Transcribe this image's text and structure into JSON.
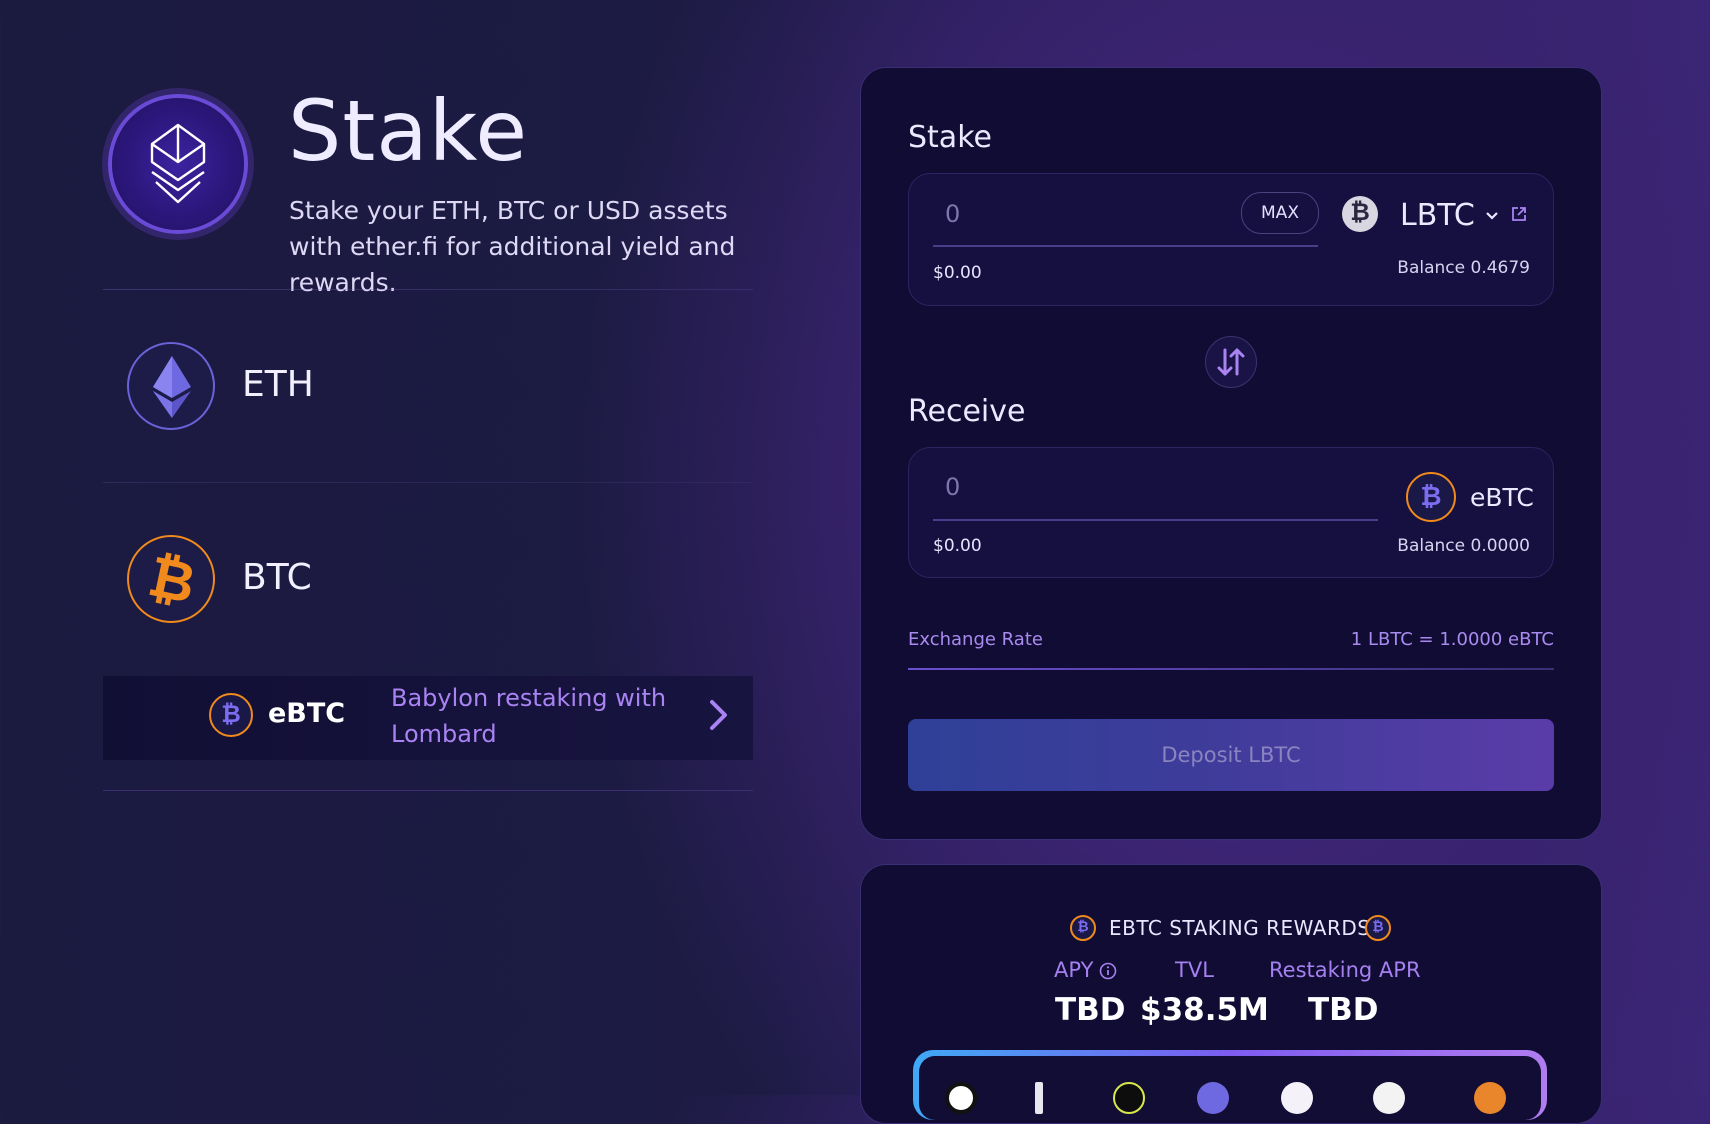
{
  "hero": {
    "title": "Stake",
    "subtitle": "Stake your ETH, BTC or USD assets with ether.fi for additional yield and rewards."
  },
  "assets": [
    {
      "label": "ETH",
      "icon": "eth-icon"
    },
    {
      "label": "BTC",
      "icon": "btc-icon"
    }
  ],
  "ebtc_row": {
    "token": "eBTC",
    "description": "Babylon restaking with Lombard"
  },
  "stake_panel": {
    "stake_label": "Stake",
    "stake_input_placeholder": "0",
    "stake_usd": "$0.00",
    "max_label": "MAX",
    "stake_token": "LBTC",
    "stake_balance": "Balance 0.4679",
    "receive_label": "Receive",
    "receive_input_placeholder": "0",
    "receive_usd": "$0.00",
    "receive_token": "eBTC",
    "receive_balance": "Balance 0.0000",
    "exchange_rate_label": "Exchange Rate",
    "exchange_rate_value": "1 LBTC = 1.0000 eBTC",
    "deposit_button": "Deposit LBTC"
  },
  "rewards": {
    "title": "EBTC STAKING REWARDS",
    "apy_label": "APY",
    "apy_value": "TBD",
    "tvl_label": "TVL",
    "tvl_value": "$38.5M",
    "restaking_label": "Restaking APR",
    "restaking_value": "TBD"
  },
  "colors": {
    "accent_purple": "#a580f0",
    "btc_orange": "#f08a1c",
    "eth_blue": "#6a62d8",
    "panel_bg": "#110c33"
  }
}
